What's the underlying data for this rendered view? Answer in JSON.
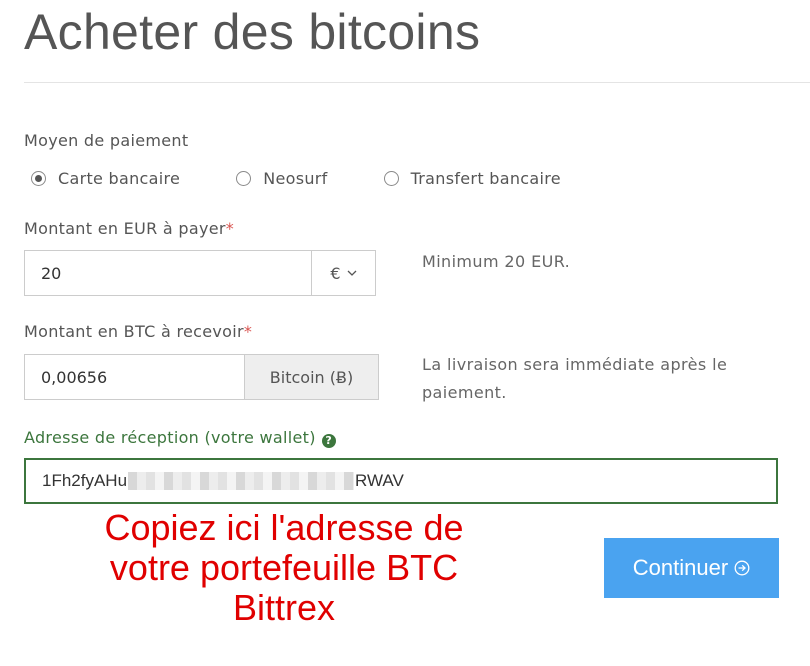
{
  "page": {
    "title": "Acheter des bitcoins"
  },
  "payment_method": {
    "label": "Moyen de paiement",
    "options": [
      {
        "label": "Carte bancaire",
        "selected": true
      },
      {
        "label": "Neosurf",
        "selected": false
      },
      {
        "label": "Transfert bancaire",
        "selected": false
      }
    ]
  },
  "amount_eur": {
    "label": "Montant en EUR à payer",
    "required_mark": "*",
    "value": "20",
    "currency_label": "€",
    "help": "Minimum 20 EUR."
  },
  "amount_btc": {
    "label": "Montant en BTC à recevoir",
    "required_mark": "*",
    "value": "0,00656",
    "unit_label": "Bitcoin (Ƀ)",
    "help_line1": "La livraison sera immédiate après le",
    "help_line2": "paiement."
  },
  "wallet": {
    "label": "Adresse de réception (votre wallet)",
    "help_icon": "?",
    "value_start": "1Fh2fyAHu",
    "value_end": "RWAV"
  },
  "annotation": {
    "line1": "Copiez ici l'adresse de",
    "line2": "votre portefeuille BTC",
    "line3": "Bittrex",
    "color": "#e00000"
  },
  "actions": {
    "continue_label": "Continuer"
  },
  "colors": {
    "primary_button": "#4aa3f0",
    "success": "#3c763d",
    "required": "#d9534f"
  }
}
